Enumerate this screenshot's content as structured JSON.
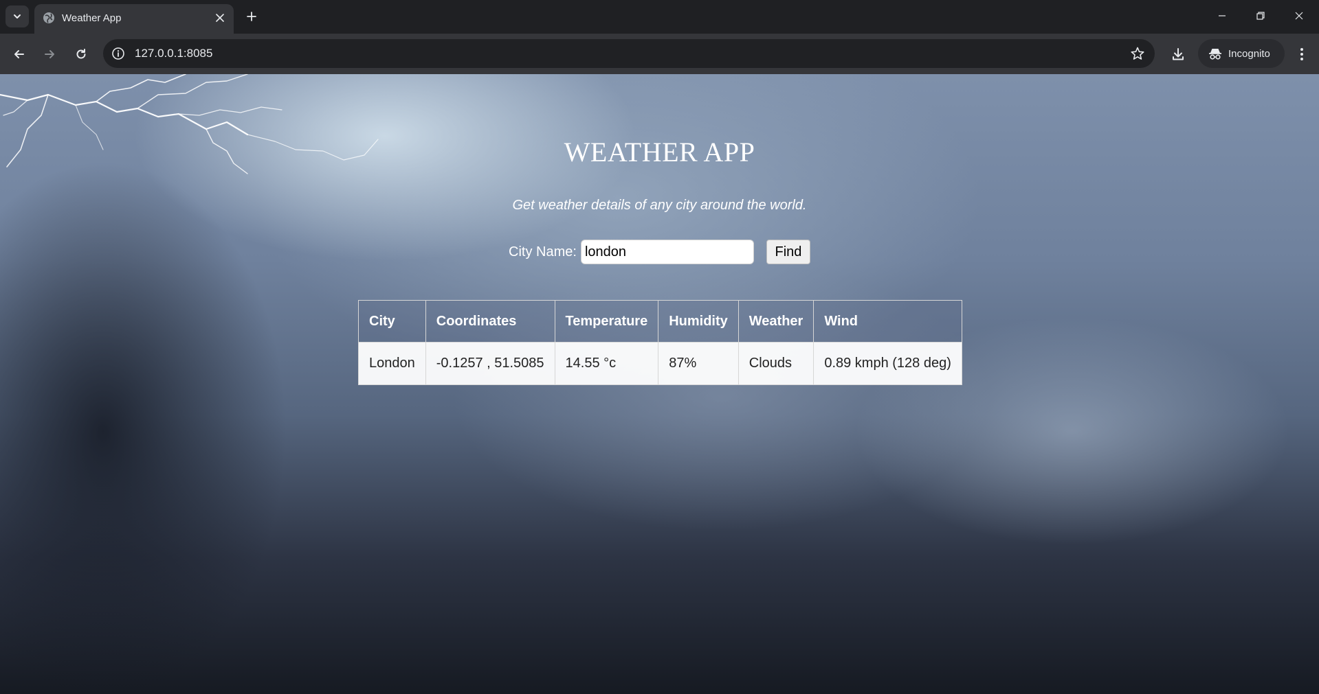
{
  "browser": {
    "tab_title": "Weather App",
    "url": "127.0.0.1:8085",
    "incognito_label": "Incognito"
  },
  "icons": {
    "tab_search": "chevron-down-icon",
    "favicon": "globe-icon",
    "tab_close": "close-icon",
    "new_tab": "plus-icon",
    "back": "arrow-left-icon",
    "forward": "arrow-right-icon",
    "reload": "reload-icon",
    "site_info": "info-icon",
    "bookmark": "star-icon",
    "download": "download-icon",
    "incognito": "incognito-icon",
    "menu": "kebab-icon"
  },
  "app": {
    "title": "WEATHER APP",
    "subtitle": "Get weather details of any city around the world.",
    "city_label": "City Name:",
    "city_value": "london",
    "find_label": "Find"
  },
  "table": {
    "headers": [
      "City",
      "Coordinates",
      "Temperature",
      "Humidity",
      "Weather",
      "Wind"
    ],
    "rows": [
      [
        "London",
        "-0.1257 , 51.5085",
        "14.55 °c",
        "87%",
        "Clouds",
        "0.89 kmph (128 deg)"
      ]
    ]
  },
  "colors": {
    "chrome_dark": "#1f2023",
    "chrome_toolbar": "#35363a",
    "text_light": "#e8eaed"
  }
}
